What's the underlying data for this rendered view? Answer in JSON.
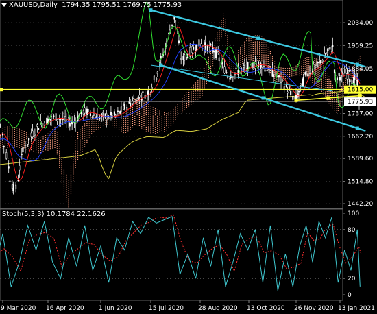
{
  "header": {
    "symbol": "XAUUSD,Daily",
    "ohlc": "1794.35 1795.51 1769.75 1775.93"
  },
  "indicator_header": {
    "name": "Stoch(5,3,3)",
    "values": "10.1784 22.1626"
  },
  "price_labels": [
    "2034.00",
    "1959.25",
    "1884.05",
    "1815.00",
    "1775.93",
    "1737.00",
    "1662.20",
    "1589.60",
    "1514.80",
    "1442.20"
  ],
  "stoch_labels": [
    "100",
    "80",
    "20",
    "0"
  ],
  "date_labels": [
    "9 Mar 2020",
    "16 Apr 2020",
    "1 Jun 2020",
    "15 Jul 2020",
    "28 Aug 2020",
    "13 Oct 2020",
    "26 Nov 2020",
    "13 Jan 2021"
  ],
  "colors": {
    "background": "#000000",
    "grid": "#303030",
    "channel": "#3cc8e0",
    "horizontal_level": "#ffff33",
    "trendline": "#ffff33",
    "close_highlight": "#ffffff",
    "candles": "#ffffff",
    "price_ma_red": "#ff2020",
    "price_ma_blue": "#2040ff",
    "long_ma": "#d8d040",
    "momentum_green": "#30e030",
    "cloud": "#ffa080",
    "stoch_main": "#40c8d0",
    "stoch_signal": "#ff3030"
  },
  "chart_data": {
    "type": "line",
    "xlabel": "",
    "ylabel": "",
    "ylim": [
      1442.2,
      2034.0
    ],
    "stoch_ylim": [
      0,
      100
    ],
    "key_levels": {
      "horizontal_support": 1815.0,
      "last_close": 1775.93
    },
    "x_ticks": [
      "9 Mar 2020",
      "16 Apr 2020",
      "1 Jun 2020",
      "15 Jul 2020",
      "28 Aug 2020",
      "13 Oct 2020",
      "26 Nov 2020",
      "13 Jan 2021"
    ],
    "x_tick_positions": [
      "2020-03-09",
      "2020-04-16",
      "2020-06-01",
      "2020-07-15",
      "2020-08-28",
      "2020-10-13",
      "2020-11-26",
      "2021-01-13"
    ],
    "series": [
      {
        "points": [
          [
            "2020-02-24",
            1650
          ],
          [
            "2020-03-09",
            1680
          ],
          [
            "2020-03-16",
            1520
          ],
          [
            "2020-03-20",
            1480
          ],
          [
            "2020-03-27",
            1625
          ],
          [
            "2020-04-09",
            1700
          ],
          [
            "2020-04-16",
            1715
          ],
          [
            "2020-04-23",
            1725
          ],
          [
            "2020-05-08",
            1705
          ],
          [
            "2020-05-18",
            1745
          ],
          [
            "2020-06-01",
            1725
          ],
          [
            "2020-06-15",
            1730
          ],
          [
            "2020-06-30",
            1780
          ],
          [
            "2020-07-15",
            1810
          ],
          [
            "2020-07-24",
            1900
          ],
          [
            "2020-08-06",
            2060
          ],
          [
            "2020-08-12",
            1910
          ],
          [
            "2020-08-20",
            1940
          ],
          [
            "2020-08-28",
            1965
          ],
          [
            "2020-09-11",
            1945
          ],
          [
            "2020-09-24",
            1860
          ],
          [
            "2020-10-13",
            1890
          ],
          [
            "2020-10-23",
            1900
          ],
          [
            "2020-11-09",
            1860
          ],
          [
            "2020-11-26",
            1780
          ],
          [
            "2020-12-08",
            1870
          ],
          [
            "2020-12-17",
            1885
          ],
          [
            "2021-01-06",
            1955
          ],
          [
            "2021-01-08",
            1850
          ],
          [
            "2021-01-20",
            1870
          ],
          [
            "2021-01-28",
            1845
          ],
          [
            "2021-02-01",
            1860
          ],
          [
            "2021-02-04",
            1775.93
          ]
        ]
      }
    ],
    "channel_upper": [
      [
        "2020-07-15",
        2075
      ],
      [
        "2021-02-10",
        1890
      ]
    ],
    "channel_lower": [
      [
        "2020-07-24",
        1895
      ],
      [
        "2021-02-10",
        1680
      ]
    ],
    "trendline": [
      [
        "2020-11-26",
        1780
      ],
      [
        "2021-02-04",
        1795
      ]
    ],
    "stoch_series": [
      [
        "2020-02-24",
        60
      ],
      [
        "2020-03-02",
        30
      ],
      [
        "2020-03-09",
        75
      ],
      [
        "2020-03-16",
        10
      ],
      [
        "2020-03-23",
        40
      ],
      [
        "2020-03-30",
        85
      ],
      [
        "2020-04-06",
        55
      ],
      [
        "2020-04-13",
        90
      ],
      [
        "2020-04-20",
        40
      ],
      [
        "2020-04-27",
        20
      ],
      [
        "2020-05-04",
        70
      ],
      [
        "2020-05-11",
        35
      ],
      [
        "2020-05-18",
        85
      ],
      [
        "2020-05-25",
        30
      ],
      [
        "2020-06-01",
        60
      ],
      [
        "2020-06-08",
        15
      ],
      [
        "2020-06-15",
        70
      ],
      [
        "2020-06-22",
        55
      ],
      [
        "2020-06-29",
        90
      ],
      [
        "2020-07-06",
        75
      ],
      [
        "2020-07-13",
        95
      ],
      [
        "2020-07-20",
        88
      ],
      [
        "2020-07-27",
        92
      ],
      [
        "2020-08-03",
        96
      ],
      [
        "2020-08-10",
        25
      ],
      [
        "2020-08-17",
        50
      ],
      [
        "2020-08-24",
        20
      ],
      [
        "2020-08-31",
        70
      ],
      [
        "2020-09-07",
        35
      ],
      [
        "2020-09-14",
        80
      ],
      [
        "2020-09-21",
        10
      ],
      [
        "2020-09-28",
        40
      ],
      [
        "2020-10-05",
        75
      ],
      [
        "2020-10-12",
        55
      ],
      [
        "2020-10-19",
        80
      ],
      [
        "2020-10-26",
        15
      ],
      [
        "2020-11-02",
        85
      ],
      [
        "2020-11-09",
        5
      ],
      [
        "2020-11-16",
        50
      ],
      [
        "2020-11-23",
        10
      ],
      [
        "2020-11-30",
        60
      ],
      [
        "2020-12-07",
        85
      ],
      [
        "2020-12-14",
        40
      ],
      [
        "2020-12-21",
        90
      ],
      [
        "2020-12-28",
        70
      ],
      [
        "2021-01-04",
        95
      ],
      [
        "2021-01-11",
        15
      ],
      [
        "2021-01-18",
        55
      ],
      [
        "2021-01-25",
        30
      ],
      [
        "2021-02-01",
        80
      ],
      [
        "2021-02-04",
        10.18
      ]
    ]
  }
}
